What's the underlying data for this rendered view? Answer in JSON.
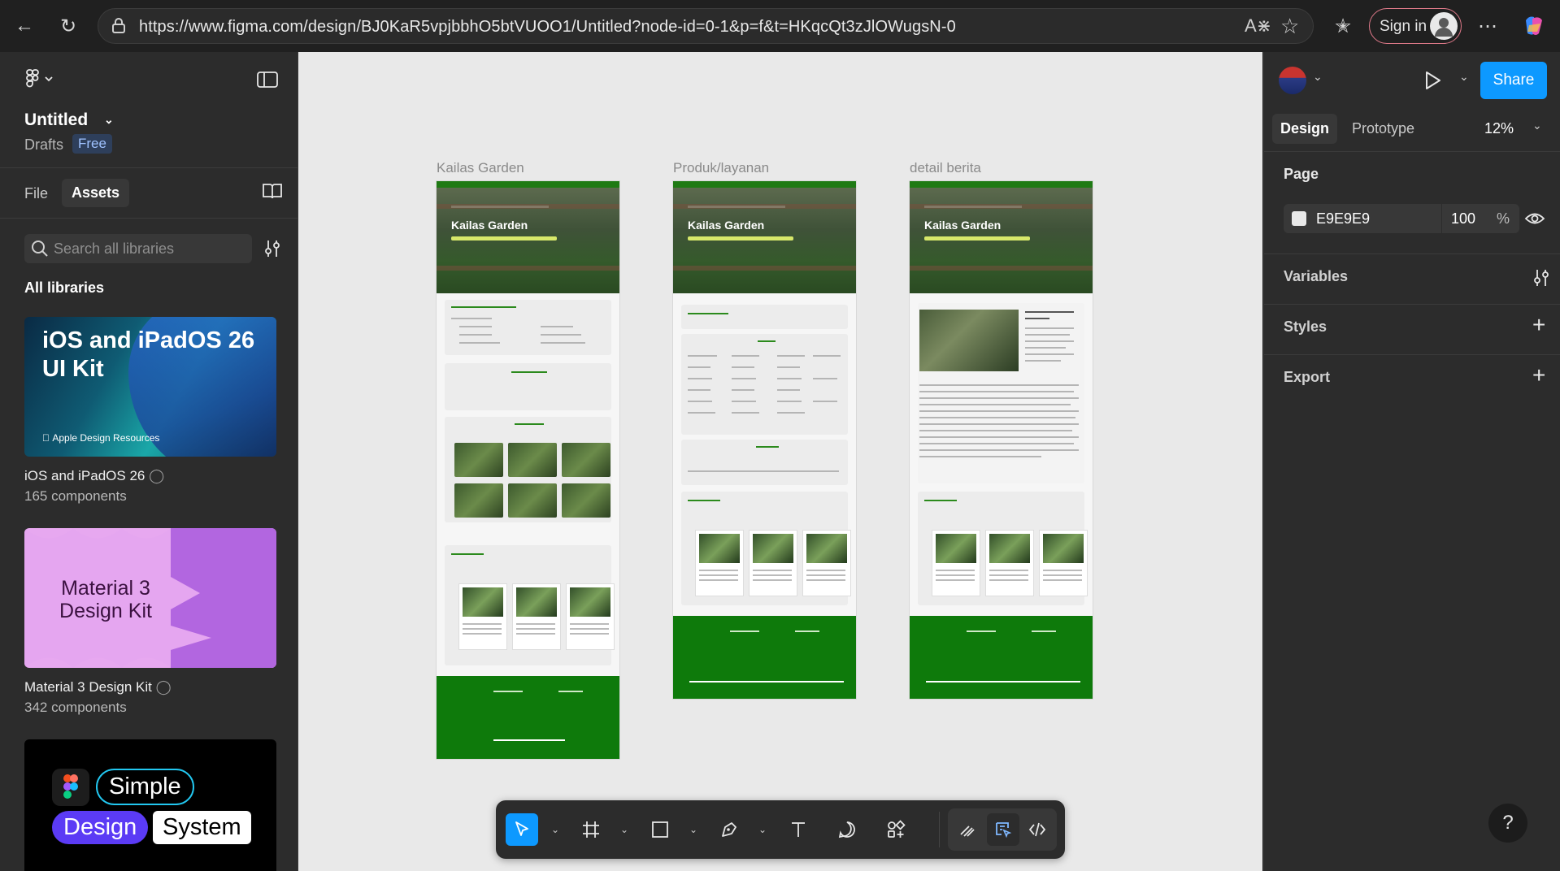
{
  "browser": {
    "url": "https://www.figma.com/design/BJ0KaR5vpjbbhO5btVUOO1/Untitled?node-id=0-1&p=f&t=HKqcQt3zJlOWugsN-0",
    "signin_label": "Sign in"
  },
  "left_panel": {
    "file_title": "Untitled",
    "drafts_label": "Drafts",
    "plan_badge": "Free",
    "tabs": {
      "file": "File",
      "assets": "Assets"
    },
    "search_placeholder": "Search all libraries",
    "section_title": "All libraries",
    "libraries": [
      {
        "title_art": "iOS and iPadOS 26 UI Kit",
        "art_footer": "Apple Design Resources",
        "name": "iOS and iPadOS 26",
        "count": "165 components"
      },
      {
        "title_art": "Material 3 Design Kit",
        "name": "Material 3 Design Kit",
        "count": "342 components"
      },
      {
        "art_words": [
          "Simple",
          "Design",
          "System"
        ]
      }
    ]
  },
  "canvas": {
    "background": "#E9E9E9",
    "frames": [
      {
        "label": "Kailas Garden"
      },
      {
        "label": "Produk/layanan"
      },
      {
        "label": "detail berita"
      }
    ],
    "hero_title": "Kailas Garden"
  },
  "toolbar": {
    "tools": [
      "move-tool",
      "frame-tool",
      "rectangle-tool",
      "pen-tool",
      "text-tool",
      "comment-tool",
      "assets-tool",
      "draw-tool",
      "dev-mode-tool",
      "code-tool"
    ]
  },
  "right_panel": {
    "share_label": "Share",
    "tabs": {
      "design": "Design",
      "prototype": "Prototype"
    },
    "zoom": "12%",
    "page_section": "Page",
    "page_color_hex": "E9E9E9",
    "page_opacity": "100",
    "page_opacity_unit": "%",
    "variables": "Variables",
    "styles": "Styles",
    "export": "Export",
    "help": "?"
  },
  "colors": {
    "accent": "#0d99ff",
    "brand_green": "#0e7a0b",
    "canvas": "#e9e9e9"
  }
}
